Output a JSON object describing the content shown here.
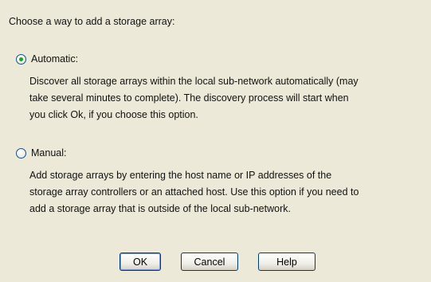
{
  "prompt": "Choose a way to add a storage array:",
  "options": {
    "automatic": {
      "label": "Automatic:",
      "selected": true,
      "description": [
        "Discover all storage arrays within the local sub-network automatically (may",
        "take several minutes to complete).  The discovery process will start when",
        "you click Ok, if you choose this option."
      ]
    },
    "manual": {
      "label": "Manual:",
      "selected": false,
      "description": [
        "Add storage arrays by entering the host name or IP addresses of the",
        "storage array controllers or an attached host.  Use this option if you need to",
        "add a storage array that is outside of the local sub-network."
      ]
    }
  },
  "buttons": {
    "ok": "OK",
    "cancel": "Cancel",
    "help": "Help"
  },
  "colors": {
    "background": "#ece9d8",
    "radio_dot": "#21a121",
    "button_border": "#003c74"
  }
}
